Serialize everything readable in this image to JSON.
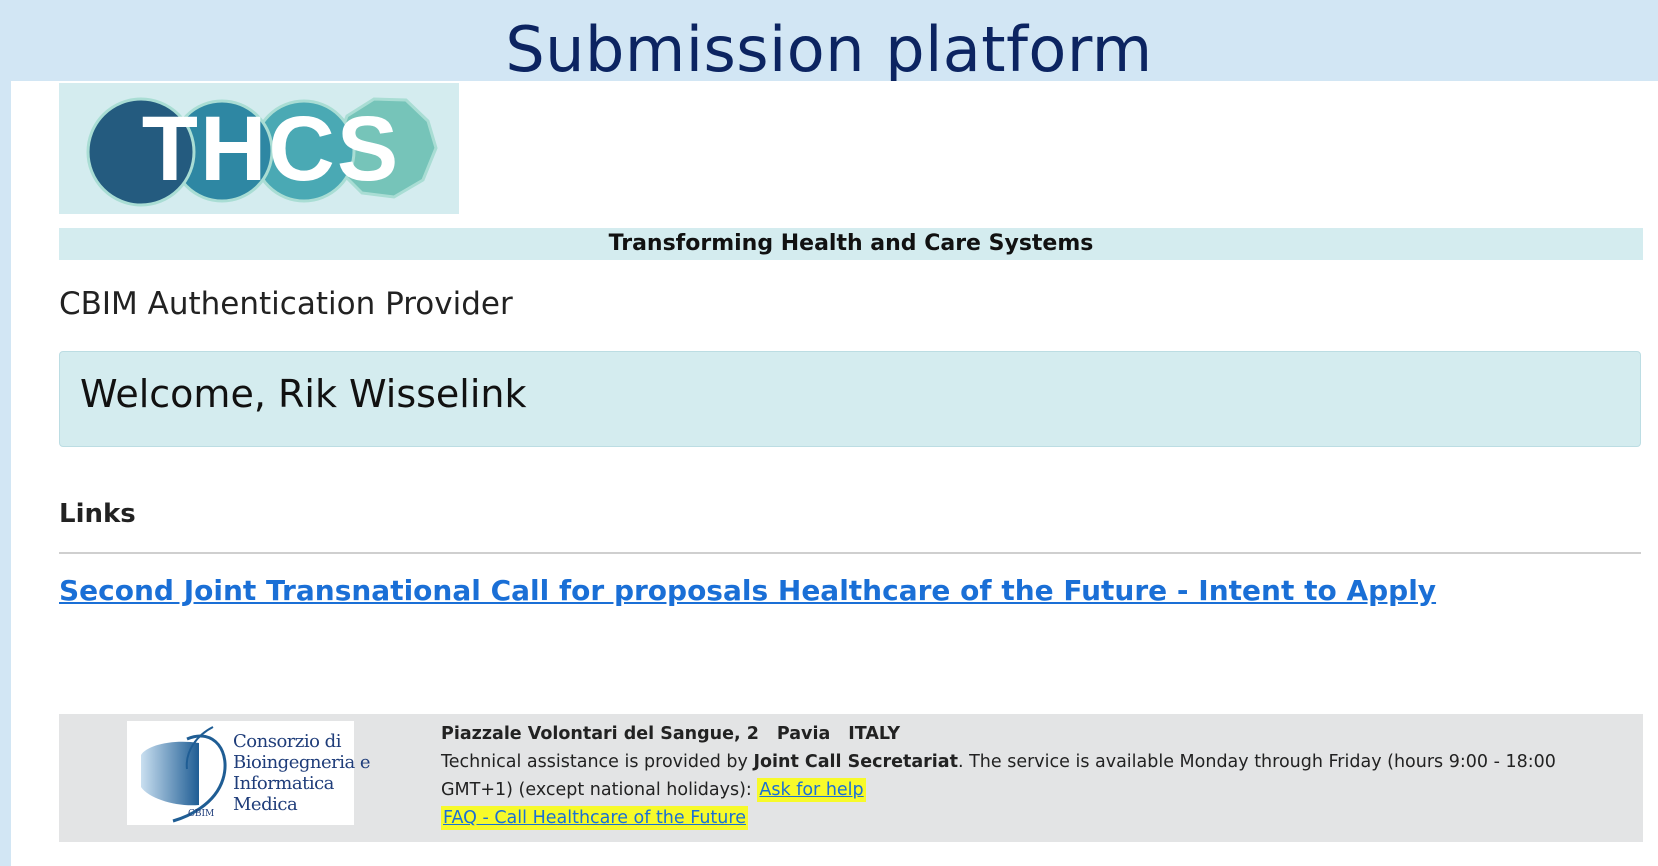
{
  "slide": {
    "title": "Submission platform"
  },
  "header": {
    "logo_text": "THCS",
    "tagline": "Transforming Health and Care Systems"
  },
  "main": {
    "provider_heading": "CBIM Authentication Provider",
    "welcome": "Welcome, Rik Wisselink",
    "links_heading": "Links",
    "links": [
      {
        "label": "Second Joint Transnational Call for proposals Healthcare of the Future - Intent to Apply"
      }
    ]
  },
  "footer": {
    "org_logo": {
      "lines": [
        "Consorzio di",
        "Bioingegneria e",
        "Informatica",
        "Medica"
      ],
      "abbr": "CBIM"
    },
    "address": {
      "street": "Piazzale Volontari del Sangue, 2",
      "city": "Pavia",
      "country": "ITALY"
    },
    "assist_prefix": "Technical assistance is provided by ",
    "assist_org": "Joint Call Secretariat",
    "assist_suffix": ". The service is available Monday through Friday (hours 9:00 - 18:00 GMT+1) (except national holidays): ",
    "help_link": "Ask for help",
    "faq_link": "FAQ - Call Healthcare of the Future"
  },
  "colors": {
    "slide_bg": "#d2e6f4",
    "title": "#0c2461",
    "panel": "#d4ecef",
    "link": "#1a6fd6",
    "highlight": "#f7fa2a",
    "footer_bg": "#e3e4e5"
  }
}
